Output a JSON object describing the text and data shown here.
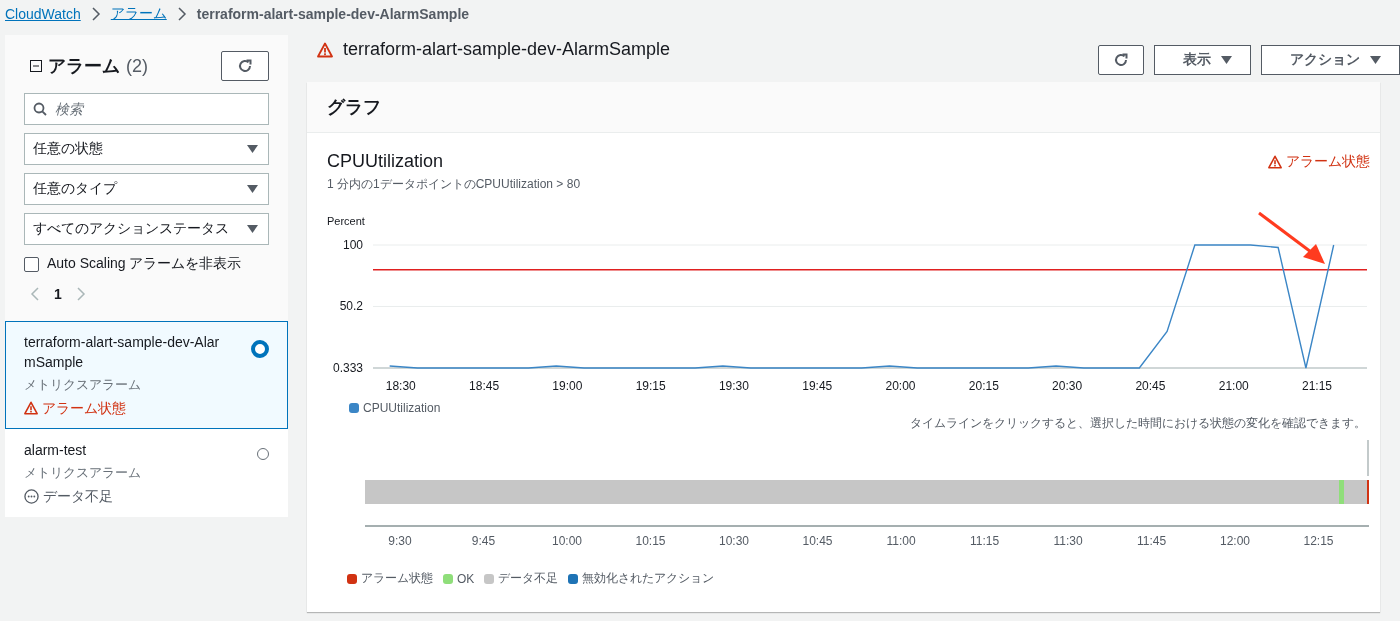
{
  "breadcrumb": [
    {
      "label": "CloudWatch",
      "link": true
    },
    {
      "label": "アラーム",
      "link": true
    },
    {
      "label": "terraform-alart-sample-dev-AlarmSample",
      "link": false
    }
  ],
  "sidebar": {
    "title": "アラーム",
    "count": "(2)",
    "search": {
      "placeholder": "検索"
    },
    "filters": [
      "任意の状態",
      "任意のタイプ",
      "すべてのアクションステータス"
    ],
    "hide_autoscaling": {
      "label": "Auto Scaling アラームを非表示",
      "checked": false
    },
    "page": "1",
    "alarms": [
      {
        "name": "terraform-alart-sample-dev-AlarmSample",
        "type": "メトリクスアラーム",
        "state": "アラーム状態",
        "kind": "alarm",
        "selected": true
      },
      {
        "name": "alarm-test",
        "type": "メトリクスアラーム",
        "state": "データ不足",
        "kind": "insufficient",
        "selected": false
      }
    ]
  },
  "header": {
    "title": "terraform-alart-sample-dev-AlarmSample",
    "buttons": [
      {
        "kind": "refresh"
      },
      {
        "kind": "dropdown",
        "label": "表示"
      },
      {
        "kind": "dropdown",
        "label": "アクション"
      }
    ]
  },
  "graph": {
    "heading": "グラフ",
    "metric": "CPUUtilization",
    "description": "1 分内の1データポイントのCPUUtilization > 80",
    "state": {
      "label": "アラーム状態",
      "kind": "alarm"
    },
    "chart_data": {
      "type": "line",
      "ylabel": "Percent",
      "x": [
        1108,
        1113,
        1118,
        1123,
        1128,
        1133,
        1138,
        1143,
        1148,
        1153,
        1158,
        1163,
        1168,
        1173,
        1178,
        1183,
        1188,
        1193,
        1198,
        1203,
        1208,
        1213,
        1218,
        1223,
        1228,
        1233,
        1238,
        1243,
        1248,
        1253,
        1258,
        1263,
        1268,
        1273,
        1278
      ],
      "series": [
        {
          "name": "CPUUtilization",
          "color": "#3b86c6",
          "values": [
            2,
            0.333,
            0.333,
            0.333,
            0.333,
            0.333,
            2,
            0.333,
            0.333,
            0.333,
            0.333,
            0.333,
            2,
            0.333,
            0.333,
            0.333,
            0.333,
            0.333,
            2,
            0.333,
            0.333,
            0.333,
            0.333,
            0.333,
            2,
            0.333,
            0.333,
            0.333,
            30,
            100,
            100,
            100,
            98,
            0.333,
            100
          ]
        }
      ],
      "ylim": [
        0.333,
        100
      ],
      "xlim": [
        1105,
        1284
      ],
      "yticks": [
        0.333,
        50.2,
        100
      ],
      "xticks": [
        {
          "value": 1110,
          "label": "18:30"
        },
        {
          "value": 1125,
          "label": "18:45"
        },
        {
          "value": 1140,
          "label": "19:00"
        },
        {
          "value": 1155,
          "label": "19:15"
        },
        {
          "value": 1170,
          "label": "19:30"
        },
        {
          "value": 1185,
          "label": "19:45"
        },
        {
          "value": 1200,
          "label": "20:00"
        },
        {
          "value": 1215,
          "label": "20:15"
        },
        {
          "value": 1230,
          "label": "20:30"
        },
        {
          "value": 1245,
          "label": "20:45"
        },
        {
          "value": 1260,
          "label": "21:00"
        },
        {
          "value": 1275,
          "label": "21:15"
        }
      ],
      "ref_lines": [
        {
          "axis": "y",
          "value": 80,
          "color": "#e02020"
        }
      ]
    },
    "timeline": {
      "hint": "タイムラインをクリックすると、選択した時間における状態の変化を確認できます。",
      "ticks": [
        "9:30",
        "9:45",
        "10:00",
        "10:15",
        "10:30",
        "10:45",
        "11:00",
        "11:15",
        "11:30",
        "11:45",
        "12:00",
        "12:15"
      ],
      "legend": [
        {
          "label": "アラーム状態",
          "color": "#d13212"
        },
        {
          "label": "OK",
          "color": "#8fde7a"
        },
        {
          "label": "データ不足",
          "color": "#c6c6c6"
        },
        {
          "label": "無効化されたアクション",
          "color": "#1e73b5"
        }
      ]
    }
  }
}
